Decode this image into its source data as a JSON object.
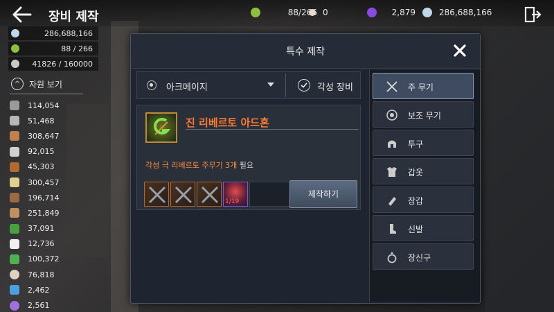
{
  "header": {
    "title": "장비 제작"
  },
  "top_resources": [
    {
      "icon": "fragment-icon",
      "value": "88/266",
      "color": "#8fbf40"
    },
    {
      "icon": "pearl-icon",
      "value": "0",
      "color": "#e8d8d0"
    },
    {
      "icon": "purple-gem-icon",
      "value": "2,879",
      "color": "#8a4be0"
    },
    {
      "icon": "silver-coin-icon",
      "value": "286,688,166",
      "color": "#bfd8e8"
    }
  ],
  "side_stats": [
    {
      "icon": "silver-coin-icon",
      "value": "286,688,166",
      "color": "#bfd8e8"
    },
    {
      "icon": "fragment-icon",
      "value": "88 / 266",
      "color": "#8fbf40"
    },
    {
      "icon": "weight-icon",
      "value": "41826 / 160000",
      "color": "#c8c8c8"
    }
  ],
  "resources": {
    "toggle_label": "자원 보기",
    "items": [
      {
        "icon": "ore-icon",
        "value": "114,054",
        "color": "#9a9a9a"
      },
      {
        "icon": "stone-icon",
        "value": "51,468",
        "color": "#b8b8b8"
      },
      {
        "icon": "wood-plank-icon",
        "value": "308,647",
        "color": "#c08050"
      },
      {
        "icon": "feather-icon",
        "value": "92,015",
        "color": "#d0d0d0"
      },
      {
        "icon": "log-icon",
        "value": "45,303",
        "color": "#b06a30"
      },
      {
        "icon": "bottle-icon",
        "value": "300,457",
        "color": "#e0d090"
      },
      {
        "icon": "leather-icon",
        "value": "196,714",
        "color": "#9a6a40"
      },
      {
        "icon": "bone-icon",
        "value": "251,849",
        "color": "#c09060"
      },
      {
        "icon": "herb-icon",
        "value": "37,091",
        "color": "#4aa040"
      },
      {
        "icon": "cotton-icon",
        "value": "12,736",
        "color": "#f0f0f0"
      },
      {
        "icon": "plant-icon",
        "value": "100,372",
        "color": "#50b050"
      },
      {
        "icon": "egg-icon",
        "value": "76,818",
        "color": "#e0d0c0"
      },
      {
        "icon": "crystal-icon",
        "value": "2,462",
        "color": "#4aa0e0"
      },
      {
        "icon": "orb-icon",
        "value": "2,561",
        "color": "#a070e0"
      }
    ]
  },
  "modal": {
    "title": "특수 제작",
    "filter": {
      "selected": "아크메이지",
      "awaken_label": "각성 장비"
    },
    "item": {
      "name": "진 리베르토 아드혼",
      "requirement_highlight": "각성 극 리베르토 주무기 3개",
      "requirement_suffix": " 필요",
      "material_count": "1/19"
    },
    "craft_label": "제작하기",
    "categories": [
      {
        "icon": "crossed-swords-icon",
        "label": "주 무기"
      },
      {
        "icon": "orb-weapon-icon",
        "label": "보조 무기"
      },
      {
        "icon": "helmet-icon",
        "label": "투구"
      },
      {
        "icon": "armor-icon",
        "label": "갑옷"
      },
      {
        "icon": "gloves-icon",
        "label": "장갑"
      },
      {
        "icon": "boots-icon",
        "label": "신발"
      },
      {
        "icon": "ring-icon",
        "label": "장신구"
      }
    ]
  }
}
